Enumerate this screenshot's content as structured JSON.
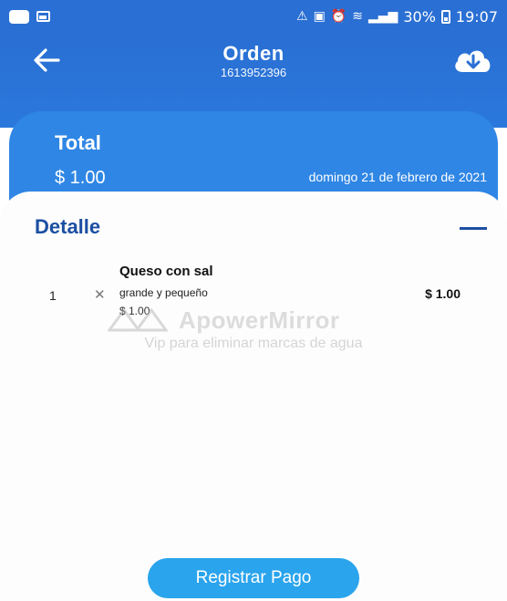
{
  "status_bar": {
    "battery_percent": "30%",
    "time": "19:07"
  },
  "header": {
    "title": "Orden",
    "order_number": "1613952396"
  },
  "total": {
    "label": "Total",
    "amount": "$ 1.00",
    "date": "domingo 21 de febrero de 2021"
  },
  "detail": {
    "title": "Detalle",
    "items": [
      {
        "quantity": "1",
        "name": "Queso con sal",
        "description": "grande y pequeño",
        "unit_price": "$ 1.00",
        "line_total": "$ 1.00"
      }
    ]
  },
  "watermark": {
    "brand": "ApowerMirror",
    "subtitle": "Vip para eliminar marcas de agua"
  },
  "actions": {
    "register_payment": "Registrar Pago"
  },
  "colors": {
    "header_blue": "#2a6fd3",
    "card_blue": "#2f86e4",
    "detail_title_blue": "#1c4fa3",
    "button_blue": "#2aa4ec"
  }
}
